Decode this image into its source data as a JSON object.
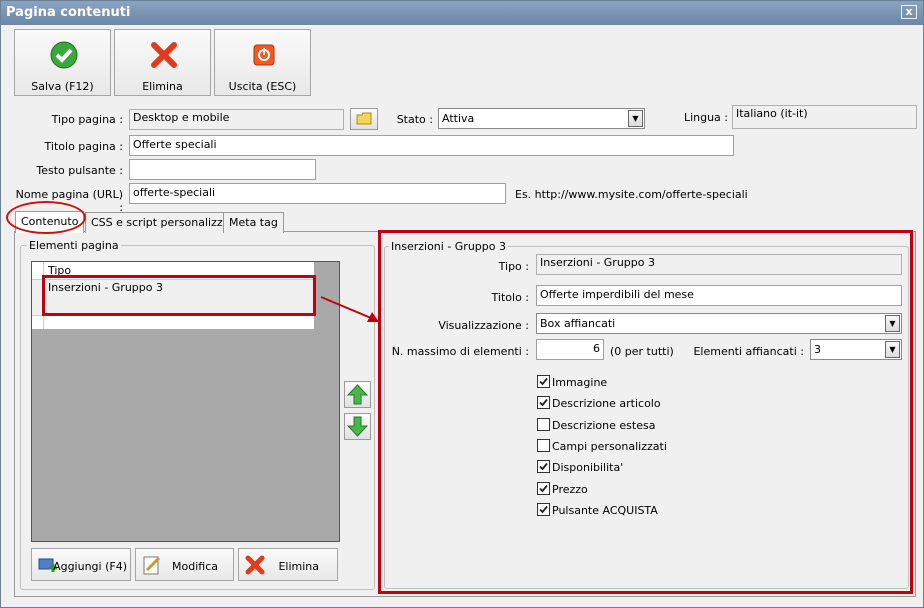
{
  "window": {
    "title": "Pagina contenuti",
    "close_glyph": "x"
  },
  "toolbar": {
    "save_label": "Salva (F12)",
    "delete_label": "Elimina",
    "exit_label": "Uscita (ESC)"
  },
  "form": {
    "tipo_pagina_label": "Tipo pagina :",
    "tipo_pagina_value": "Desktop e mobile",
    "stato_label": "Stato :",
    "stato_value": "Attiva",
    "lingua_label": "Lingua :",
    "lingua_value": "Italiano (it-it)",
    "titolo_pagina_label": "Titolo pagina :",
    "titolo_pagina_value": "Offerte speciali",
    "testo_pulsante_label": "Testo pulsante :",
    "testo_pulsante_value": "",
    "nome_pagina_label": "Nome pagina (URL) :",
    "nome_pagina_value": "offerte-speciali",
    "url_example": "Es. http://www.mysite.com/offerte-speciali"
  },
  "tabs": [
    "Contenuto",
    "CSS e script personalizzati",
    "Meta tag"
  ],
  "elements_panel": {
    "title": "Elementi pagina",
    "column_header": "Tipo",
    "rows": [
      "Inserzioni - Gruppo 3"
    ],
    "add_label": "Aggiungi (F4)",
    "edit_label": "Modifica",
    "delete_label": "Elimina"
  },
  "details": {
    "title": "Inserzioni - Gruppo 3",
    "tipo_label": "Tipo :",
    "tipo_value": "Inserzioni - Gruppo 3",
    "titolo_label": "Titolo :",
    "titolo_value": "Offerte imperdibili del mese",
    "visualizzazione_label": "Visualizzazione :",
    "visualizzazione_value": "Box affiancati",
    "max_label": "N. massimo di elementi :",
    "max_value": "6",
    "max_hint": "(0 per tutti)",
    "affiancati_label": "Elementi affiancati :",
    "affiancati_value": "3",
    "checkboxes": [
      {
        "label": "Immagine",
        "checked": true
      },
      {
        "label": "Descrizione articolo",
        "checked": true
      },
      {
        "label": "Descrizione estesa",
        "checked": false
      },
      {
        "label": "Campi personalizzati",
        "checked": false
      },
      {
        "label": "Disponibilita'",
        "checked": true
      },
      {
        "label": "Prezzo",
        "checked": true
      },
      {
        "label": "Pulsante ACQUISTA",
        "checked": true
      }
    ]
  },
  "colors": {
    "annotation_red": "#c0000d",
    "titlebar": "#7a93b3"
  }
}
